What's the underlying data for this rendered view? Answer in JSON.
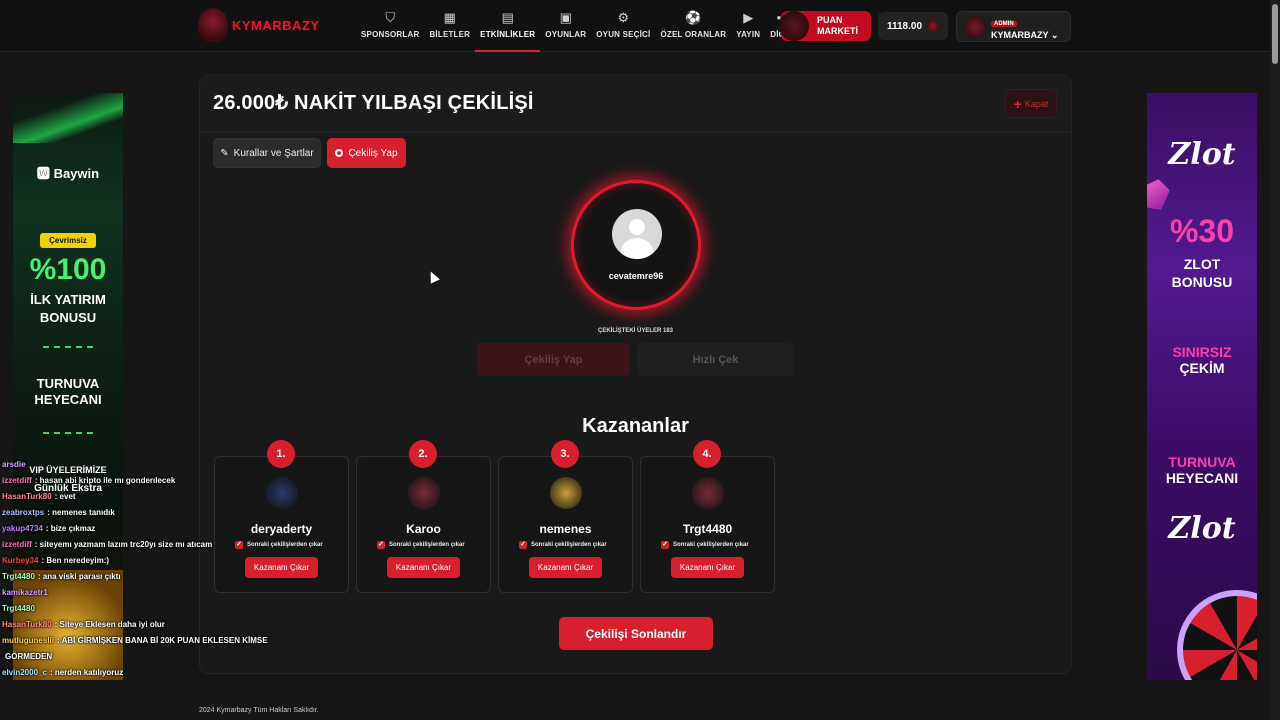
{
  "header": {
    "logo_text": "KYMARBAZY",
    "nav": [
      {
        "label": "SPONSORLAR",
        "icon": "shield-icon",
        "glyph": "⛉"
      },
      {
        "label": "BİLETLER",
        "icon": "building-icon",
        "glyph": "▦"
      },
      {
        "label": "ETKİNLİKLER",
        "icon": "calendar-icon",
        "glyph": "▤"
      },
      {
        "label": "OYUNLAR",
        "icon": "cards-icon",
        "glyph": "▣"
      },
      {
        "label": "OYUN SEÇİCİ",
        "icon": "gear-icon",
        "glyph": "⚙"
      },
      {
        "label": "ÖZEL ORANLAR",
        "icon": "ball-icon",
        "glyph": "⚽"
      },
      {
        "label": "YAYIN",
        "icon": "video-icon",
        "glyph": "▶"
      },
      {
        "label": "DİĞER",
        "icon": "dots-icon",
        "glyph": "•••"
      }
    ],
    "active_nav": "ETKİNLİKLER",
    "puan_line1": "PUAN",
    "puan_line2": "MARKETİ",
    "balance": "1118.00",
    "admin_badge": "ADMIN",
    "username": "KYMARBAZY",
    "accent": "#d81f2e"
  },
  "panel": {
    "title": "26.000₺ NAKİT YILBAŞI ÇEKİLİŞİ",
    "close_label": "Kapat",
    "rules_label": "Kurallar ve Şartlar",
    "draw_label": "Çekiliş Yap",
    "current_user": "cevatemre96",
    "members_text": "ÇEKİLİŞTEKİ ÜYELER 183",
    "draw_button": "Çekiliş Yap",
    "fast_button": "Hızlı Çek",
    "winners_title": "Kazananlar",
    "exclude_text": "Sonraki çekilişlerden çıkar",
    "remove_label": "Kazananı Çıkar",
    "end_label": "Çekilişi Sonlandır"
  },
  "winners": [
    {
      "rank": "1.",
      "name": "deryaderty",
      "avatar_color": "#2a3a66"
    },
    {
      "rank": "2.",
      "name": "Karoo",
      "avatar_color": "#7a2a3a"
    },
    {
      "rank": "3.",
      "name": "nemenes",
      "avatar_color": "#c9a23a"
    },
    {
      "rank": "4.",
      "name": "Trgt4480",
      "avatar_color": "#7a2a3a"
    }
  ],
  "footer": "2024 Kymarbazy Tüm Hakları Saklıdır.",
  "left_banner": {
    "brand": "Baywin",
    "tag": "Çevrimsiz",
    "big": "%100",
    "line1": "İLK YATIRIM",
    "line2": "BONUSU",
    "line3": "TURNUVA",
    "line4": "HEYECANI",
    "line5": "VIP ÜYELERİMİZE",
    "line6": "Günlük Ekstra"
  },
  "right_banner": {
    "brand": "Zlot",
    "big": "%30",
    "line1": "ZLOT",
    "line2": "BONUSU",
    "line3": "SINIRSIZ",
    "line4": "ÇEKİM",
    "line5": "TURNUVA",
    "line6": "HEYECANI",
    "brand2": "Zlot"
  },
  "chat": [
    {
      "user": "arsdie",
      "msg": "",
      "color": "#d0a0ff"
    },
    {
      "user": "izzetdiff",
      "msg": ": hasan abi kripto ile mı gonderılecek",
      "color": "#ff6fb0"
    },
    {
      "user": "HasanTurk80",
      "msg": ": evet",
      "color": "#ff8a8a"
    },
    {
      "user": "zeabroxtps",
      "msg": ": nemenes tanıdık",
      "color": "#a0c4ff"
    },
    {
      "user": "yakup4734",
      "msg": ": bize çıkmaz",
      "color": "#c080ff"
    },
    {
      "user": "izzetdiff",
      "msg": ": siteyemı yazmam lazım trc20yı size mı atıcam",
      "color": "#ff6fb0"
    },
    {
      "user": "Kurbey34",
      "msg": ": Ben neredeyim:)",
      "color": "#ff4040"
    },
    {
      "user": "Trgt4480",
      "msg": ": ana viski parası çıktı",
      "color": "#9fffb0"
    },
    {
      "user": "kamikazetr1",
      "msg": "",
      "color": "#d0a0ff"
    },
    {
      "user": "Trgt4480",
      "msg": "",
      "color": "#9fffb0"
    },
    {
      "user": "HasanTurk80",
      "msg": ": Siteye Eklesen daha iyi olur",
      "color": "#ff8a8a"
    },
    {
      "user": "mutluguneslii",
      "msg": ": ABİ GİRMİŞKEN BANA Bİ 20K PUAN EKLESEN KİMSE",
      "color": "#ffd24a"
    },
    {
      "user": "",
      "msg": "GÖRMEDEN",
      "color": "#ffffff"
    },
    {
      "user": "elvin2000_c",
      "msg": ": nerden katılıyoruz",
      "color": "#a0e0ff"
    }
  ]
}
